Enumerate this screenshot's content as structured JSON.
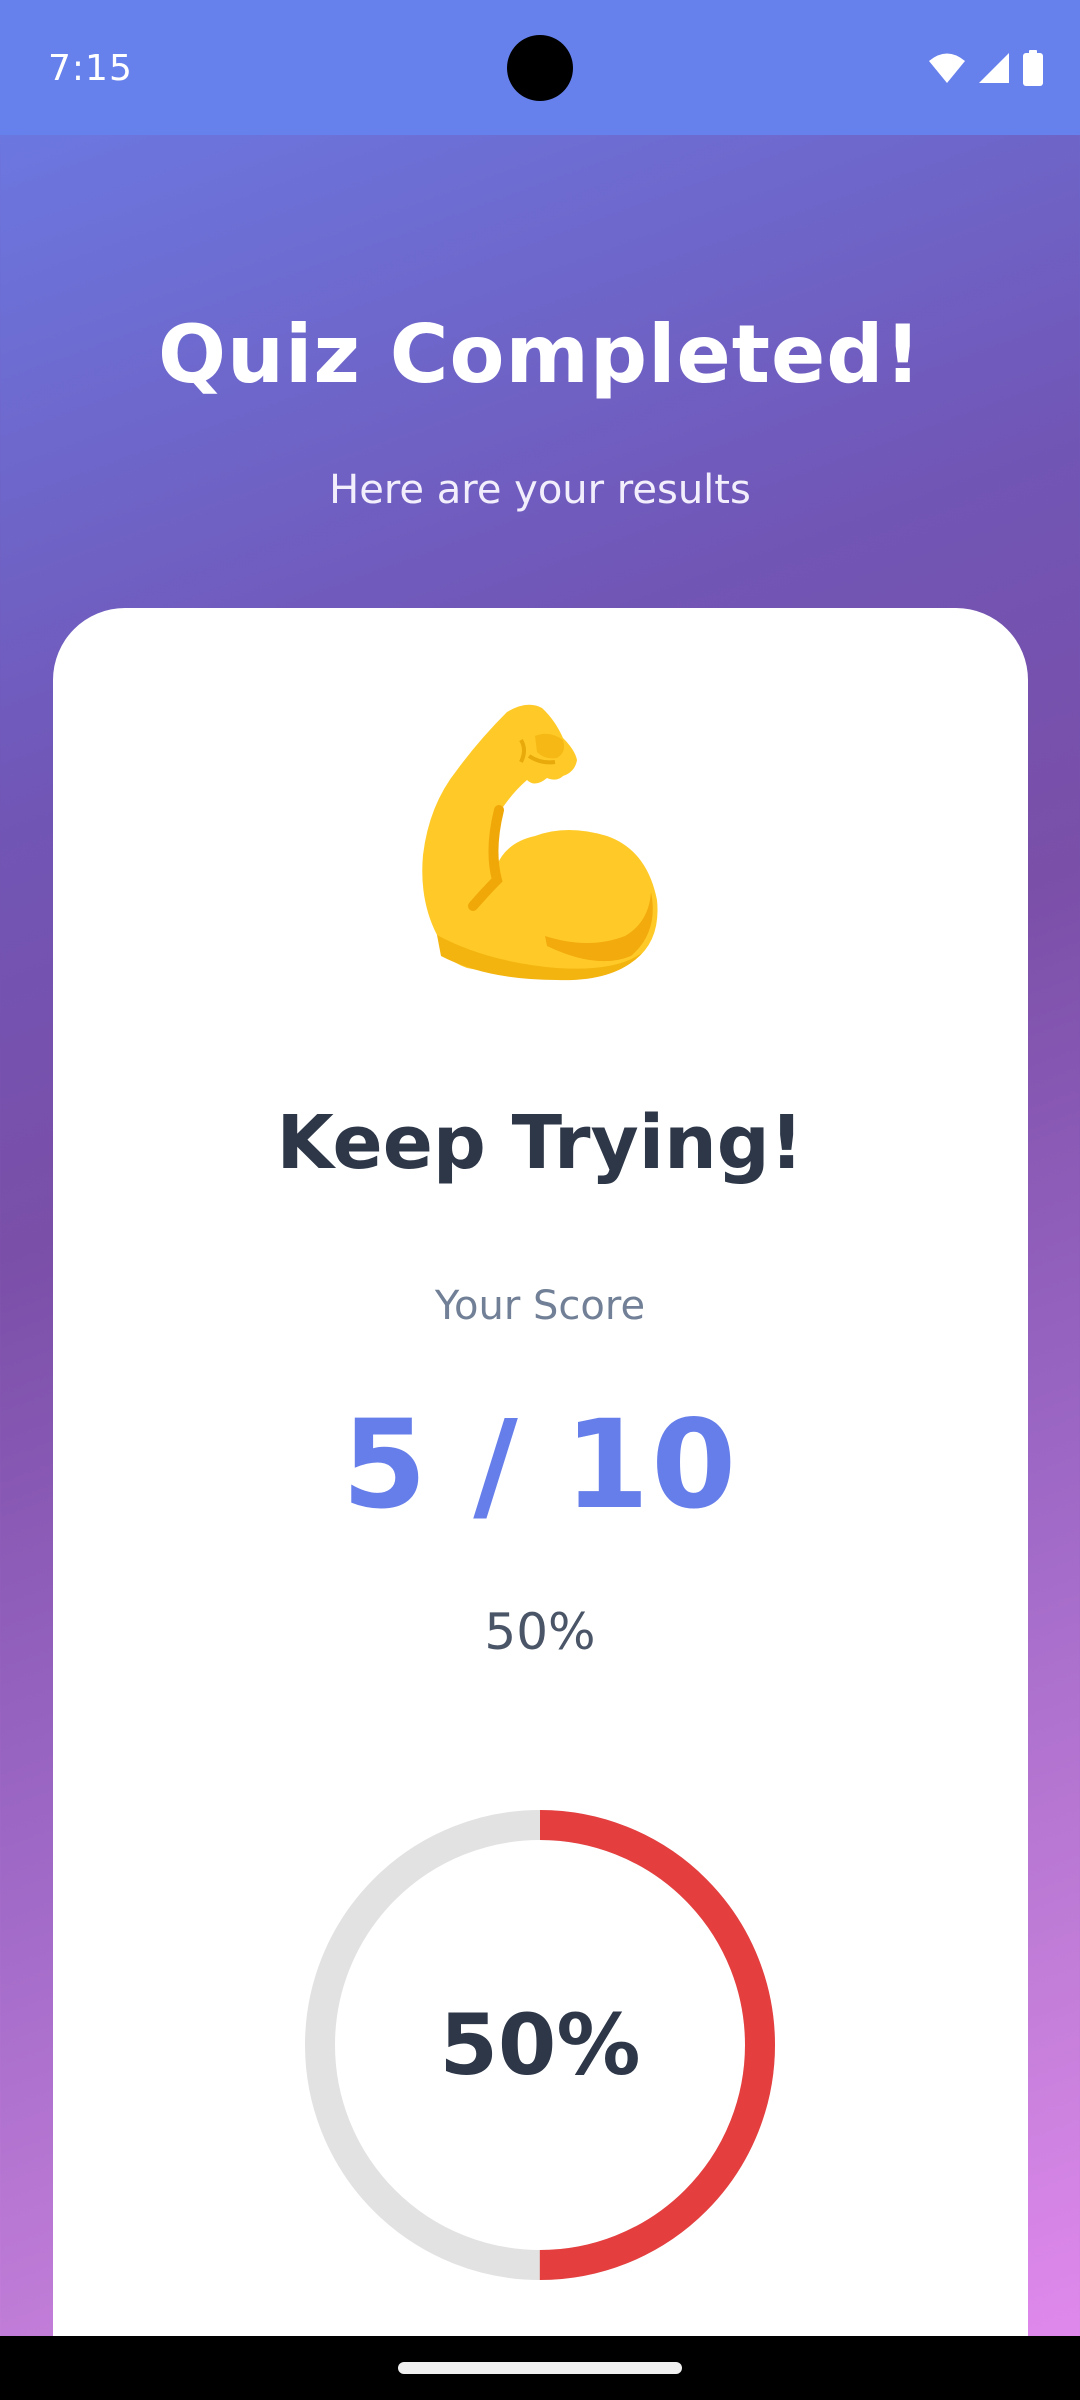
{
  "status_bar": {
    "time": "7:15",
    "icons": [
      "wifi-icon",
      "cellular-signal-icon",
      "battery-icon"
    ]
  },
  "header": {
    "title": "Quiz Completed!",
    "subtitle": "Here are your results"
  },
  "result": {
    "emoji": "flexed-biceps-icon",
    "title": "Keep Trying!",
    "score_label": "Your Score",
    "score_value": "5 / 10",
    "percent_text": "50%"
  },
  "progress": {
    "value": 0.5,
    "label": "50%",
    "fill_color": "#e53e3e",
    "track_color": "#e2e2e2"
  },
  "colors": {
    "accent": "#667eea",
    "status_bar": "#6680ec",
    "heading_text": "#2d3748",
    "muted_text": "#718096"
  }
}
